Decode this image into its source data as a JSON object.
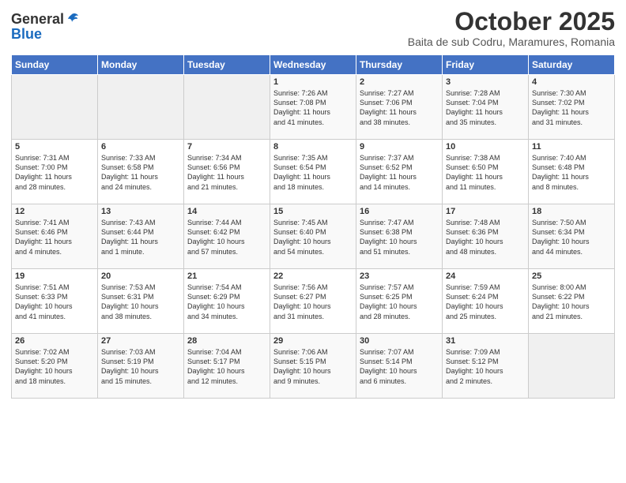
{
  "header": {
    "logo_general": "General",
    "logo_blue": "Blue",
    "month": "October 2025",
    "location": "Baita de sub Codru, Maramures, Romania"
  },
  "weekdays": [
    "Sunday",
    "Monday",
    "Tuesday",
    "Wednesday",
    "Thursday",
    "Friday",
    "Saturday"
  ],
  "weeks": [
    [
      {
        "day": "",
        "info": ""
      },
      {
        "day": "",
        "info": ""
      },
      {
        "day": "",
        "info": ""
      },
      {
        "day": "1",
        "info": "Sunrise: 7:26 AM\nSunset: 7:08 PM\nDaylight: 11 hours\nand 41 minutes."
      },
      {
        "day": "2",
        "info": "Sunrise: 7:27 AM\nSunset: 7:06 PM\nDaylight: 11 hours\nand 38 minutes."
      },
      {
        "day": "3",
        "info": "Sunrise: 7:28 AM\nSunset: 7:04 PM\nDaylight: 11 hours\nand 35 minutes."
      },
      {
        "day": "4",
        "info": "Sunrise: 7:30 AM\nSunset: 7:02 PM\nDaylight: 11 hours\nand 31 minutes."
      }
    ],
    [
      {
        "day": "5",
        "info": "Sunrise: 7:31 AM\nSunset: 7:00 PM\nDaylight: 11 hours\nand 28 minutes."
      },
      {
        "day": "6",
        "info": "Sunrise: 7:33 AM\nSunset: 6:58 PM\nDaylight: 11 hours\nand 24 minutes."
      },
      {
        "day": "7",
        "info": "Sunrise: 7:34 AM\nSunset: 6:56 PM\nDaylight: 11 hours\nand 21 minutes."
      },
      {
        "day": "8",
        "info": "Sunrise: 7:35 AM\nSunset: 6:54 PM\nDaylight: 11 hours\nand 18 minutes."
      },
      {
        "day": "9",
        "info": "Sunrise: 7:37 AM\nSunset: 6:52 PM\nDaylight: 11 hours\nand 14 minutes."
      },
      {
        "day": "10",
        "info": "Sunrise: 7:38 AM\nSunset: 6:50 PM\nDaylight: 11 hours\nand 11 minutes."
      },
      {
        "day": "11",
        "info": "Sunrise: 7:40 AM\nSunset: 6:48 PM\nDaylight: 11 hours\nand 8 minutes."
      }
    ],
    [
      {
        "day": "12",
        "info": "Sunrise: 7:41 AM\nSunset: 6:46 PM\nDaylight: 11 hours\nand 4 minutes."
      },
      {
        "day": "13",
        "info": "Sunrise: 7:43 AM\nSunset: 6:44 PM\nDaylight: 11 hours\nand 1 minute."
      },
      {
        "day": "14",
        "info": "Sunrise: 7:44 AM\nSunset: 6:42 PM\nDaylight: 10 hours\nand 57 minutes."
      },
      {
        "day": "15",
        "info": "Sunrise: 7:45 AM\nSunset: 6:40 PM\nDaylight: 10 hours\nand 54 minutes."
      },
      {
        "day": "16",
        "info": "Sunrise: 7:47 AM\nSunset: 6:38 PM\nDaylight: 10 hours\nand 51 minutes."
      },
      {
        "day": "17",
        "info": "Sunrise: 7:48 AM\nSunset: 6:36 PM\nDaylight: 10 hours\nand 48 minutes."
      },
      {
        "day": "18",
        "info": "Sunrise: 7:50 AM\nSunset: 6:34 PM\nDaylight: 10 hours\nand 44 minutes."
      }
    ],
    [
      {
        "day": "19",
        "info": "Sunrise: 7:51 AM\nSunset: 6:33 PM\nDaylight: 10 hours\nand 41 minutes."
      },
      {
        "day": "20",
        "info": "Sunrise: 7:53 AM\nSunset: 6:31 PM\nDaylight: 10 hours\nand 38 minutes."
      },
      {
        "day": "21",
        "info": "Sunrise: 7:54 AM\nSunset: 6:29 PM\nDaylight: 10 hours\nand 34 minutes."
      },
      {
        "day": "22",
        "info": "Sunrise: 7:56 AM\nSunset: 6:27 PM\nDaylight: 10 hours\nand 31 minutes."
      },
      {
        "day": "23",
        "info": "Sunrise: 7:57 AM\nSunset: 6:25 PM\nDaylight: 10 hours\nand 28 minutes."
      },
      {
        "day": "24",
        "info": "Sunrise: 7:59 AM\nSunset: 6:24 PM\nDaylight: 10 hours\nand 25 minutes."
      },
      {
        "day": "25",
        "info": "Sunrise: 8:00 AM\nSunset: 6:22 PM\nDaylight: 10 hours\nand 21 minutes."
      }
    ],
    [
      {
        "day": "26",
        "info": "Sunrise: 7:02 AM\nSunset: 5:20 PM\nDaylight: 10 hours\nand 18 minutes."
      },
      {
        "day": "27",
        "info": "Sunrise: 7:03 AM\nSunset: 5:19 PM\nDaylight: 10 hours\nand 15 minutes."
      },
      {
        "day": "28",
        "info": "Sunrise: 7:04 AM\nSunset: 5:17 PM\nDaylight: 10 hours\nand 12 minutes."
      },
      {
        "day": "29",
        "info": "Sunrise: 7:06 AM\nSunset: 5:15 PM\nDaylight: 10 hours\nand 9 minutes."
      },
      {
        "day": "30",
        "info": "Sunrise: 7:07 AM\nSunset: 5:14 PM\nDaylight: 10 hours\nand 6 minutes."
      },
      {
        "day": "31",
        "info": "Sunrise: 7:09 AM\nSunset: 5:12 PM\nDaylight: 10 hours\nand 2 minutes."
      },
      {
        "day": "",
        "info": ""
      }
    ]
  ]
}
